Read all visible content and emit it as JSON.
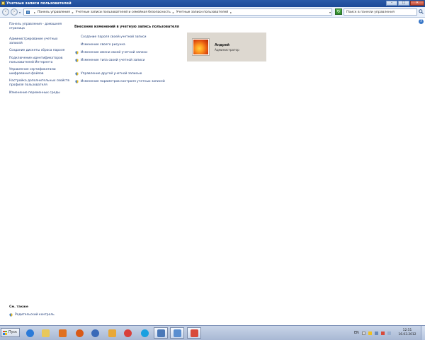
{
  "window": {
    "title": "Учетные записи пользователей",
    "buttons": {
      "minimize": "–",
      "maximize": "□",
      "close": "✕"
    }
  },
  "toolbar": {
    "breadcrumbs": [
      "Панель управления",
      "Учетные записи пользователей и семейная безопасность",
      "Учетные записи пользователей"
    ],
    "search_placeholder": "Поиск в панели управления"
  },
  "sidebar": {
    "home": "Панель управления - домашняя страница",
    "items": [
      "Администрирование учетных записей",
      "Создание дискеты сброса пароля",
      "Подключение идентификаторов пользователей Интернета",
      "Управление сертификатами шифрования файлов",
      "Настройка дополнительных свойств профиля пользователя",
      "Изменение переменных среды"
    ]
  },
  "see_also": {
    "heading": "См. также",
    "items": [
      "Родительский контроль"
    ]
  },
  "main": {
    "heading": "Внесение изменений в учетную запись пользователя",
    "tasks": [
      "Создание пароля своей учетной записи",
      "Изменение своего рисунка",
      "Изменение имени своей учетной записи",
      "Изменение типа своей учетной записи"
    ],
    "other_tasks": [
      "Управление другой учетной записью",
      "Изменение параметров контроля учетных записей"
    ]
  },
  "user": {
    "name": "Андрей",
    "role": "Администратор"
  },
  "taskbar": {
    "start_label": "Пуск",
    "apps": [
      {
        "name": "internet-explorer",
        "color": "#2a7ad8"
      },
      {
        "name": "explorer",
        "color": "#e8c85a"
      },
      {
        "name": "media-player",
        "color": "#e07020"
      },
      {
        "name": "firefox",
        "color": "#d85a18"
      },
      {
        "name": "thunderbird",
        "color": "#3a6ab8"
      },
      {
        "name": "folder-app",
        "color": "#e8a838"
      },
      {
        "name": "chrome",
        "color": "#d8403a"
      },
      {
        "name": "skype",
        "color": "#1aa0e0"
      },
      {
        "name": "document-app",
        "color": "#4a78b8"
      },
      {
        "name": "control-panel-window",
        "color": "#5a8ed0"
      },
      {
        "name": "presentation-app",
        "color": "#d84a3a"
      }
    ],
    "language": "EN",
    "time": "12:51",
    "date": "16.03.2012"
  }
}
